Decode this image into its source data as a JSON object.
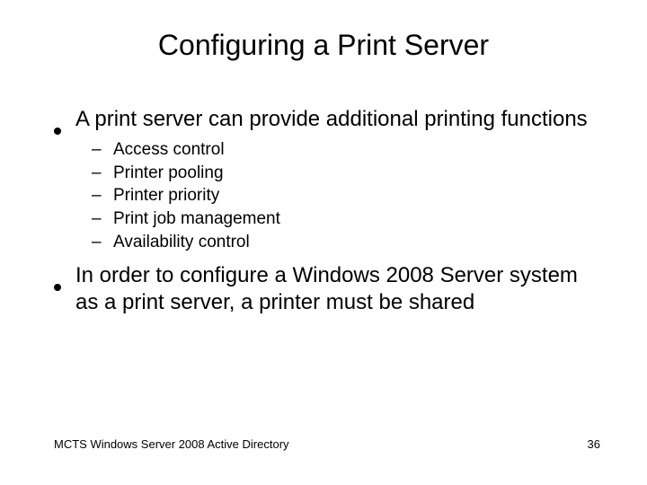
{
  "title": "Configuring a Print Server",
  "bullets": [
    {
      "text": "A print server can provide additional printing functions",
      "sub": [
        "Access control",
        "Printer pooling",
        "Printer priority",
        "Print job management",
        "Availability control"
      ]
    },
    {
      "text": "In order to configure a Windows 2008 Server system as a print server, a printer must be shared",
      "sub": []
    }
  ],
  "footer": {
    "left": "MCTS Windows Server 2008 Active Directory",
    "right": "36"
  }
}
